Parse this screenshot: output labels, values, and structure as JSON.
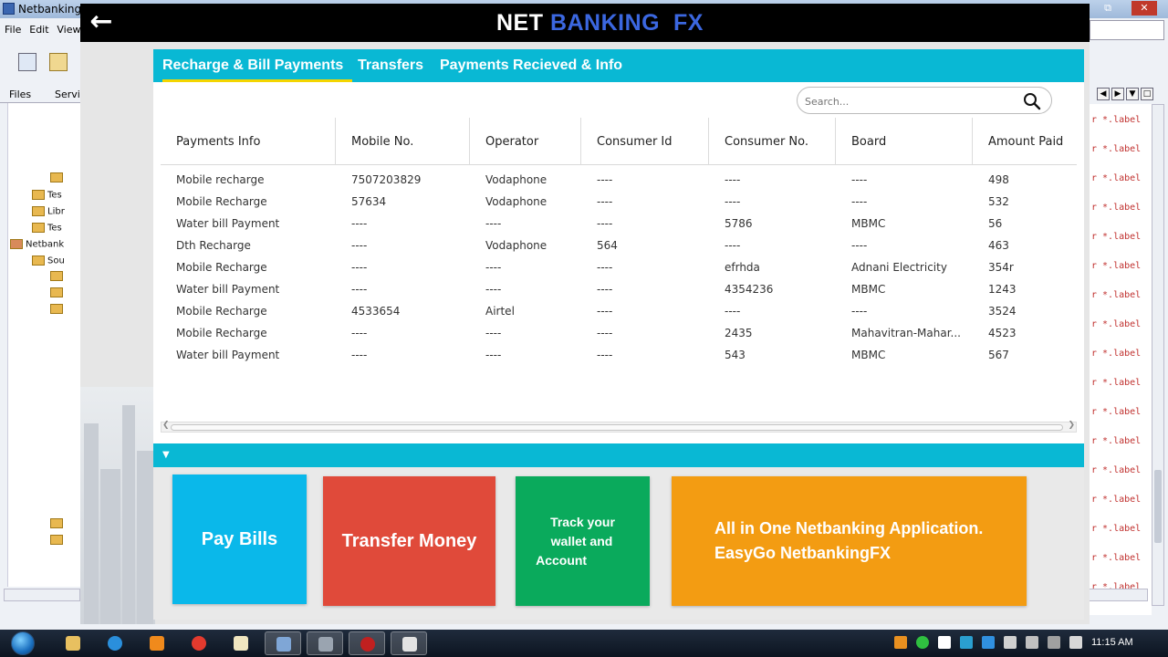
{
  "ide": {
    "title": "NetbankingF",
    "window_buttons": [
      "⧉",
      "✕"
    ],
    "menu": [
      "File",
      "Edit",
      "View"
    ],
    "tabs": [
      "Files",
      "Servic"
    ],
    "tree": [
      "Tes",
      "Libr",
      "Tes",
      "Netbank",
      "Sou"
    ],
    "code_line": "r *.label"
  },
  "app": {
    "brand_part1": "NET",
    "brand_part2": "BANKING  FX",
    "back_icon": "left-arrow-icon",
    "tabs": [
      {
        "label": "Recharge & Bill Payments",
        "active": true
      },
      {
        "label": "Transfers",
        "active": false
      },
      {
        "label": "Payments Recieved & Info",
        "active": false
      }
    ],
    "search_placeholder": "Search...",
    "columns": [
      "Payments Info",
      "Mobile No.",
      "Operator",
      "Consumer Id",
      "Consumer No.",
      "Board",
      "Amount Paid"
    ],
    "rows": [
      [
        "Mobile recharge",
        "7507203829",
        "Vodaphone",
        "----",
        "----",
        "----",
        "498"
      ],
      [
        "Mobile Recharge",
        "57634",
        "Vodaphone",
        "----",
        "----",
        "----",
        "532"
      ],
      [
        "Water bill Payment",
        "----",
        "----",
        "----",
        "5786",
        "MBMC",
        "56"
      ],
      [
        "Dth Recharge",
        "----",
        "Vodaphone",
        "564",
        "----",
        "----",
        "463"
      ],
      [
        "Mobile Recharge",
        "----",
        "----",
        "----",
        "efrhda",
        "Adnani Electricity",
        "354r"
      ],
      [
        "Water bill Payment",
        "----",
        "----",
        "----",
        "4354236",
        "MBMC",
        "1243"
      ],
      [
        "Mobile Recharge",
        "4533654",
        "Airtel",
        "----",
        "----",
        "----",
        "3524"
      ],
      [
        "Mobile Recharge",
        "----",
        "----",
        "----",
        "2435",
        "Mahavitran-Mahar...",
        "4523"
      ],
      [
        "Water bill Payment",
        "----",
        "----",
        "----",
        "543",
        "MBMC",
        "567"
      ]
    ],
    "tiles": {
      "pay": "Pay Bills",
      "transfer": "Transfer Money",
      "track_lines": [
        "Track your",
        "wallet and",
        "Account"
      ],
      "allinone_lines": [
        "All in One Netbanking Application.",
        "EasyGo NetbankingFX"
      ]
    },
    "colors": {
      "accent_cyan": "#09b8d4",
      "tab_underline": "#f4d500",
      "brand_blue": "#3b67e0",
      "tile_pay": "#0ab8ea",
      "tile_transfer": "#e04a3a",
      "tile_track": "#0aaa5c",
      "tile_allinone": "#f39c12"
    }
  },
  "taskbar": {
    "clock": "11:15 AM"
  }
}
